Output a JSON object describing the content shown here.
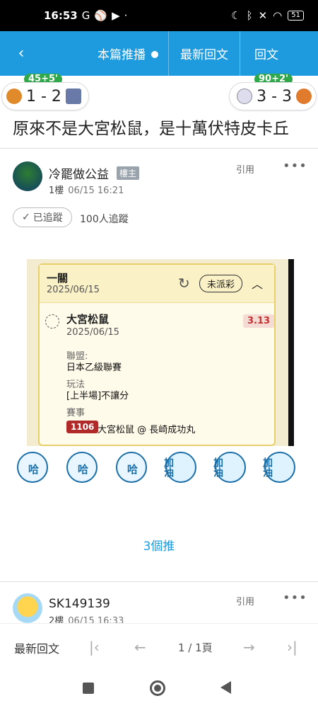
{
  "status_bar": {
    "time": "16:53",
    "app_icons": [
      "G",
      "⚾",
      "▶",
      "·"
    ],
    "battery": "51"
  },
  "header": {
    "back_icon": "back-arrow-icon",
    "live_label": "本篇推播",
    "latest_label": "最新回文",
    "reply_label": "回文"
  },
  "scores": {
    "left": {
      "time": "45+5'",
      "score": "1 - 2"
    },
    "right": {
      "time": "90+2'",
      "score": "3 - 3"
    }
  },
  "thread_title": "原來不是大宮松鼠，是十萬伏特皮卡丘",
  "post1": {
    "username": "冷罷做公益",
    "role": "樓主",
    "floor": "1樓",
    "timestamp": "06/15 16:21",
    "quote_label": "引用",
    "more": "•••",
    "follow_label": "已追蹤",
    "follow_count": "100人追蹤",
    "embed": {
      "card_title": "一關",
      "card_date": "2025/06/15",
      "status_badge": "未派彩",
      "team": "大宮松鼠",
      "team_date": "2025/06/15",
      "odds": "3.13",
      "league_label": "聯盟:",
      "league": "日本乙級聯賽",
      "play_label": "玩法",
      "play": "[上半場]不讓分",
      "event_label": "賽事",
      "event_id": "1106",
      "event_name": "大宮松鼠 @ 長崎成功丸"
    },
    "stickers": [
      {
        "text": "哈"
      },
      {
        "text": "哈"
      },
      {
        "text": "哈"
      },
      {
        "text": "加油"
      },
      {
        "text": "加油"
      },
      {
        "text": "加油"
      }
    ],
    "push_label": "3個推"
  },
  "post2": {
    "username": "SK149139",
    "floor": "2樓",
    "timestamp": "06/15 16:33",
    "quote_label": "引用",
    "more": "•••"
  },
  "bottom_nav": {
    "latest_label": "最新回文",
    "page": "1 / 1頁"
  },
  "colors": {
    "header": "#1e9bdf",
    "green_badge": "#2fa84a",
    "event_tag": "#b02a2a"
  }
}
